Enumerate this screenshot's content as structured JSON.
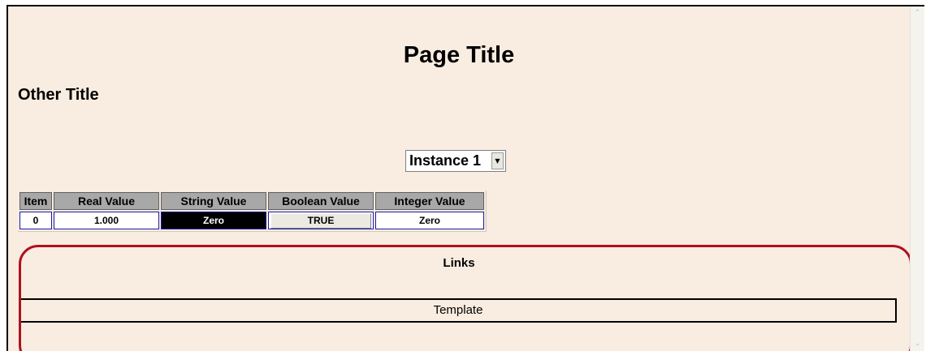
{
  "page_title": "Page Title",
  "other_title": "Other Title",
  "instance_select": {
    "value": "Instance 1",
    "arrow": "▼"
  },
  "table": {
    "headers": [
      "Item",
      "Real Value",
      "String Value",
      "Boolean Value",
      "Integer Value"
    ],
    "rows": [
      {
        "item": "0",
        "real": "1.000",
        "string": "Zero",
        "boolean": "TRUE",
        "integer": "Zero"
      }
    ]
  },
  "links": {
    "title": "Links",
    "template_label": "Template"
  },
  "scrollbar": {
    "up_arrow": "⌃",
    "down_arrow": "⌄"
  },
  "colors": {
    "background": "#f9ece0",
    "header_bg": "#a8a8a8",
    "cell_border": "#1a1aa8",
    "highlight": "#b01020"
  }
}
